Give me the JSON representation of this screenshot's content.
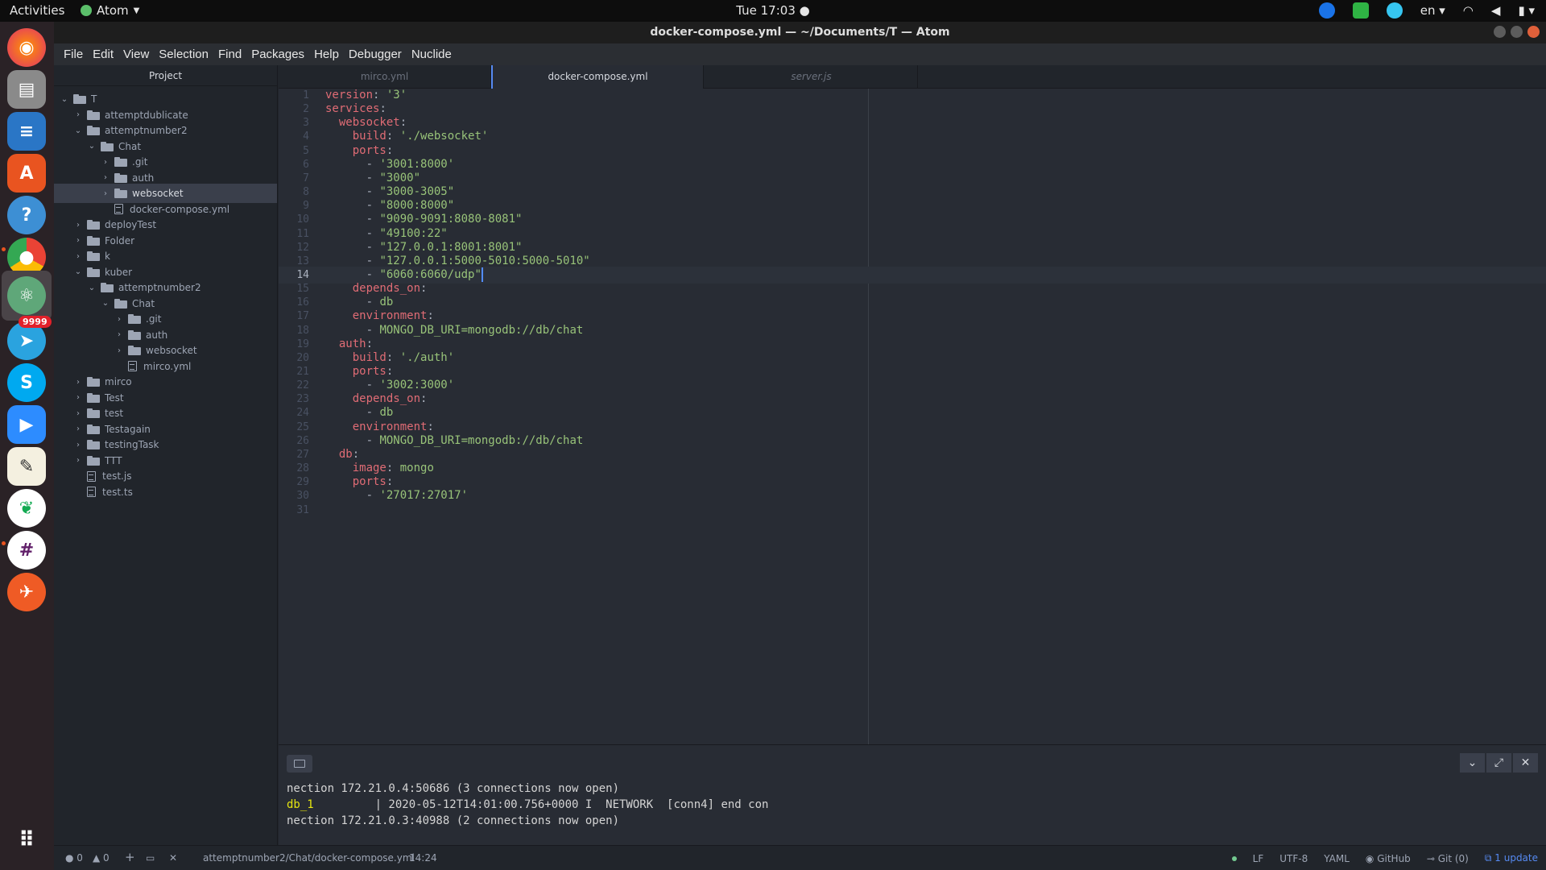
{
  "topbar": {
    "activities": "Activities",
    "app_name": "Atom",
    "clock": "Tue 17:03 ●",
    "language": "en"
  },
  "window": {
    "title": "docker-compose.yml — ~/Documents/T — Atom"
  },
  "dock": {
    "apps": [
      "firefox-icon",
      "files-icon",
      "writer-icon",
      "software-icon",
      "help-icon",
      "chrome-icon",
      "atom-icon",
      "telegram-icon",
      "skype-icon",
      "zoom-icon",
      "text-editor-icon",
      "mongodb-icon",
      "slack-icon",
      "postman-icon",
      "app-grid-icon"
    ],
    "telegram_badge": "9999"
  },
  "menu": [
    "File",
    "Edit",
    "View",
    "Selection",
    "Find",
    "Packages",
    "Help",
    "Debugger",
    "Nuclide"
  ],
  "tree": {
    "header": "Project",
    "rows": [
      {
        "label": "T",
        "type": "folder",
        "depth": 0,
        "expanded": true
      },
      {
        "label": "attemptdublicate",
        "type": "folder",
        "depth": 1,
        "expanded": false
      },
      {
        "label": "attemptnumber2",
        "type": "folder",
        "depth": 1,
        "expanded": true
      },
      {
        "label": "Chat",
        "type": "folder",
        "depth": 2,
        "expanded": true
      },
      {
        "label": ".git",
        "type": "folder",
        "depth": 3,
        "expanded": false
      },
      {
        "label": "auth",
        "type": "folder",
        "depth": 3,
        "expanded": false
      },
      {
        "label": "websocket",
        "type": "folder",
        "depth": 3,
        "expanded": false,
        "selected": true
      },
      {
        "label": "docker-compose.yml",
        "type": "file",
        "depth": 3
      },
      {
        "label": "deployTest",
        "type": "folder",
        "depth": 1,
        "expanded": false
      },
      {
        "label": "Folder",
        "type": "folder",
        "depth": 1,
        "expanded": false
      },
      {
        "label": "k",
        "type": "folder",
        "depth": 1,
        "expanded": false
      },
      {
        "label": "kuber",
        "type": "folder",
        "depth": 1,
        "expanded": true
      },
      {
        "label": "attemptnumber2",
        "type": "folder",
        "depth": 2,
        "expanded": true
      },
      {
        "label": "Chat",
        "type": "folder",
        "depth": 3,
        "expanded": true
      },
      {
        "label": ".git",
        "type": "folder",
        "depth": 4,
        "expanded": false
      },
      {
        "label": "auth",
        "type": "folder",
        "depth": 4,
        "expanded": false
      },
      {
        "label": "websocket",
        "type": "folder",
        "depth": 4,
        "expanded": false
      },
      {
        "label": "mirco.yml",
        "type": "file",
        "depth": 4
      },
      {
        "label": "mirco",
        "type": "folder",
        "depth": 1,
        "expanded": false
      },
      {
        "label": "Test",
        "type": "folder",
        "depth": 1,
        "expanded": false
      },
      {
        "label": "test",
        "type": "folder",
        "depth": 1,
        "expanded": false
      },
      {
        "label": "Testagain",
        "type": "folder",
        "depth": 1,
        "expanded": false
      },
      {
        "label": "testingTask",
        "type": "folder",
        "depth": 1,
        "expanded": false
      },
      {
        "label": "TTT",
        "type": "folder",
        "depth": 1,
        "expanded": false
      },
      {
        "label": "test.js",
        "type": "file",
        "depth": 1
      },
      {
        "label": "test.ts",
        "type": "file",
        "depth": 1
      }
    ]
  },
  "tabs": [
    {
      "label": "mirco.yml",
      "active": false,
      "italic": false
    },
    {
      "label": "docker-compose.yml",
      "active": true,
      "italic": false
    },
    {
      "label": "server.js",
      "active": false,
      "italic": true
    }
  ],
  "editor": {
    "current_line": 14,
    "lines": [
      [
        [
          "k",
          "version"
        ],
        [
          "p",
          ": "
        ],
        [
          "s",
          "'3'"
        ]
      ],
      [
        [
          "k",
          "services"
        ],
        [
          "p",
          ":"
        ]
      ],
      [
        [
          "p",
          "  "
        ],
        [
          "k",
          "websocket"
        ],
        [
          "p",
          ":"
        ]
      ],
      [
        [
          "p",
          "    "
        ],
        [
          "k",
          "build"
        ],
        [
          "p",
          ": "
        ],
        [
          "s",
          "'./websocket'"
        ]
      ],
      [
        [
          "p",
          "    "
        ],
        [
          "k",
          "ports"
        ],
        [
          "p",
          ":"
        ]
      ],
      [
        [
          "p",
          "      - "
        ],
        [
          "s",
          "'3001:8000'"
        ]
      ],
      [
        [
          "p",
          "      - "
        ],
        [
          "s",
          "\"3000\""
        ]
      ],
      [
        [
          "p",
          "      - "
        ],
        [
          "s",
          "\"3000-3005\""
        ]
      ],
      [
        [
          "p",
          "      - "
        ],
        [
          "s",
          "\"8000:8000\""
        ]
      ],
      [
        [
          "p",
          "      - "
        ],
        [
          "s",
          "\"9090-9091:8080-8081\""
        ]
      ],
      [
        [
          "p",
          "      - "
        ],
        [
          "s",
          "\"49100:22\""
        ]
      ],
      [
        [
          "p",
          "      - "
        ],
        [
          "s",
          "\"127.0.0.1:8001:8001\""
        ]
      ],
      [
        [
          "p",
          "      - "
        ],
        [
          "s",
          "\"127.0.0.1:5000-5010:5000-5010\""
        ]
      ],
      [
        [
          "p",
          "      - "
        ],
        [
          "s",
          "\"6060:6060/udp\""
        ]
      ],
      [
        [
          "p",
          "    "
        ],
        [
          "k",
          "depends_on"
        ],
        [
          "p",
          ":"
        ]
      ],
      [
        [
          "p",
          "      - "
        ],
        [
          "s",
          "db"
        ]
      ],
      [
        [
          "p",
          "    "
        ],
        [
          "k",
          "environment"
        ],
        [
          "p",
          ":"
        ]
      ],
      [
        [
          "p",
          "      - "
        ],
        [
          "s",
          "MONGO_DB_URI=mongodb://db/chat"
        ]
      ],
      [
        [
          "p",
          "  "
        ],
        [
          "k",
          "auth"
        ],
        [
          "p",
          ":"
        ]
      ],
      [
        [
          "p",
          "    "
        ],
        [
          "k",
          "build"
        ],
        [
          "p",
          ": "
        ],
        [
          "s",
          "'./auth'"
        ]
      ],
      [
        [
          "p",
          "    "
        ],
        [
          "k",
          "ports"
        ],
        [
          "p",
          ":"
        ]
      ],
      [
        [
          "p",
          "      - "
        ],
        [
          "s",
          "'3002:3000'"
        ]
      ],
      [
        [
          "p",
          "    "
        ],
        [
          "k",
          "depends_on"
        ],
        [
          "p",
          ":"
        ]
      ],
      [
        [
          "p",
          "      - "
        ],
        [
          "s",
          "db"
        ]
      ],
      [
        [
          "p",
          "    "
        ],
        [
          "k",
          "environment"
        ],
        [
          "p",
          ":"
        ]
      ],
      [
        [
          "p",
          "      - "
        ],
        [
          "s",
          "MONGO_DB_URI=mongodb://db/chat"
        ]
      ],
      [
        [
          "p",
          "  "
        ],
        [
          "k",
          "db"
        ],
        [
          "p",
          ":"
        ]
      ],
      [
        [
          "p",
          "    "
        ],
        [
          "k",
          "image"
        ],
        [
          "p",
          ": "
        ],
        [
          "s",
          "mongo"
        ]
      ],
      [
        [
          "p",
          "    "
        ],
        [
          "k",
          "ports"
        ],
        [
          "p",
          ":"
        ]
      ],
      [
        [
          "p",
          "      - "
        ],
        [
          "s",
          "'27017:27017'"
        ]
      ],
      []
    ]
  },
  "terminal": {
    "line1": "nection 172.21.0.4:50686 (3 connections now open)",
    "line2_service": "db_1",
    "line2_rest": "         | 2020-05-12T14:01:00.756+0000 I  NETWORK  [conn4] end con",
    "line3": "nection 172.21.0.3:40988 (2 connections now open)"
  },
  "statusbar": {
    "errors": "0",
    "warnings": "0",
    "file_path": "attemptnumber2/Chat/docker-compose.yml",
    "cursor": "14:24",
    "line_ending": "LF",
    "encoding": "UTF-8",
    "grammar": "YAML",
    "github": "GitHub",
    "git": "Git (0)",
    "update": "1 update"
  },
  "colors": {
    "keyword": "#e06c75",
    "string": "#98c379",
    "accent": "#568af2"
  }
}
